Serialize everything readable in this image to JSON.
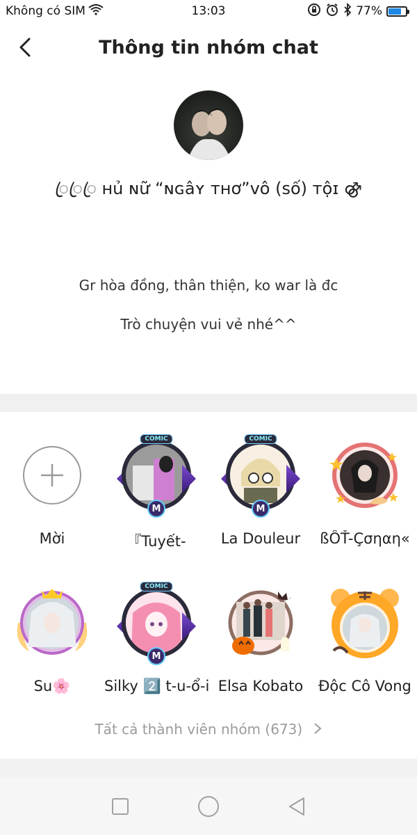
{
  "status_bar": {
    "carrier": "Không có SIM",
    "time": "13:03",
    "battery": "77%",
    "battery_level": 0.77
  },
  "header": {
    "title": "Thông tin nhóm chat"
  },
  "group": {
    "name": "ꦿꦿꦿ ʜủ ɴữ “ɴɢâʏ ᴛʜơ”ᴠô (ѕố) ᴛộɪ ⚣",
    "description_line1": "Gr hòa đồng, thân thiện, ko war là đc",
    "description_line2": "Trò chuyện vui vẻ nhé^^"
  },
  "members": [
    {
      "name": "Mời",
      "avatar": "plus-icon"
    },
    {
      "name": "『Tuyết-",
      "avatar": "comic-frame"
    },
    {
      "name": "La Douleur",
      "avatar": "comic-frame"
    },
    {
      "name": "ßỖŤ-Çσηαη«",
      "avatar": "star-frame"
    },
    {
      "name": "Su🌸",
      "avatar": "angel-frame"
    },
    {
      "name": "Silky 2️⃣ t-u-ổ-i",
      "avatar": "comic-frame"
    },
    {
      "name": "Elsa Kobato",
      "avatar": "halloween-frame"
    },
    {
      "name": "Độc Cô Vong",
      "avatar": "tiger-frame"
    }
  ],
  "frame_badges": {
    "top": "COMIC",
    "bottom": "M"
  },
  "all_members": "Tất cả thành viên nhóm (673)",
  "colors": {
    "accent_blue": "#1e88e5",
    "muted_text": "#9b9b9b",
    "band": "#f0f0f0"
  }
}
